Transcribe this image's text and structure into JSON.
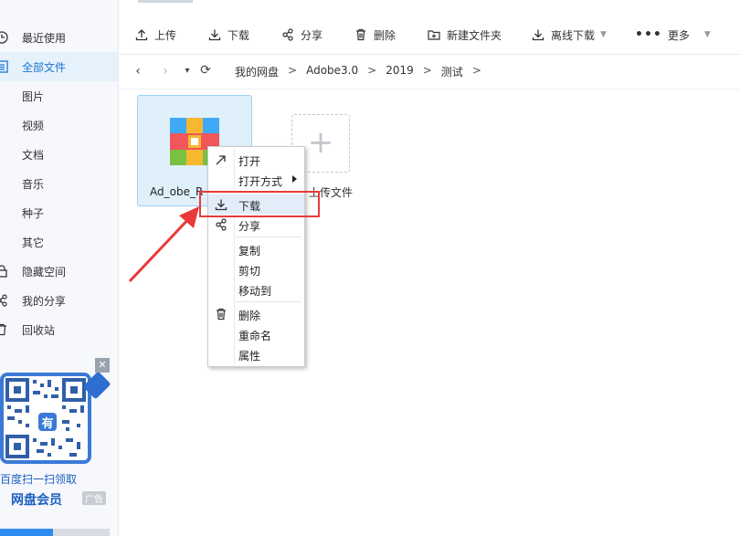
{
  "sidebar": {
    "items": [
      {
        "label": "最近使用",
        "icon": "clock-icon"
      },
      {
        "label": "全部文件",
        "icon": "list-icon",
        "active": true
      },
      {
        "label": "图片"
      },
      {
        "label": "视频"
      },
      {
        "label": "文档"
      },
      {
        "label": "音乐"
      },
      {
        "label": "种子"
      },
      {
        "label": "其它"
      },
      {
        "label": "隐藏空间",
        "icon": "lock-icon"
      },
      {
        "label": "我的分享",
        "icon": "share-icon"
      },
      {
        "label": "回收站",
        "icon": "trash-icon"
      }
    ],
    "promo": {
      "line1": "百度扫一扫领取",
      "line2": "网盘会员",
      "ad_tag": "广告",
      "close": "✕",
      "qr_badge": "有"
    }
  },
  "toolbar": {
    "upload": "上传",
    "download": "下载",
    "share": "分享",
    "delete": "删除",
    "new_folder": "新建文件夹",
    "offline_download": "离线下载",
    "more": "更多"
  },
  "address": {
    "back": "‹",
    "forward": "›",
    "dropdown": "▾",
    "refresh": "⟳",
    "crumbs": [
      "我的网盘",
      "Adobe3.0",
      "2019",
      "测试"
    ],
    "sep": ">"
  },
  "files": {
    "selected_name": "Ad_obe_R",
    "upload_label": "上传文件"
  },
  "context_menu": {
    "open": "打开",
    "open_with": "打开方式",
    "download": "下载",
    "share": "分享",
    "copy": "复制",
    "cut": "剪切",
    "move_to": "移动到",
    "delete": "删除",
    "rename": "重命名",
    "properties": "属性"
  },
  "colors": {
    "accent": "#1976d2",
    "highlight": "#e83a3a",
    "selected_bg": "#dff0fb"
  }
}
